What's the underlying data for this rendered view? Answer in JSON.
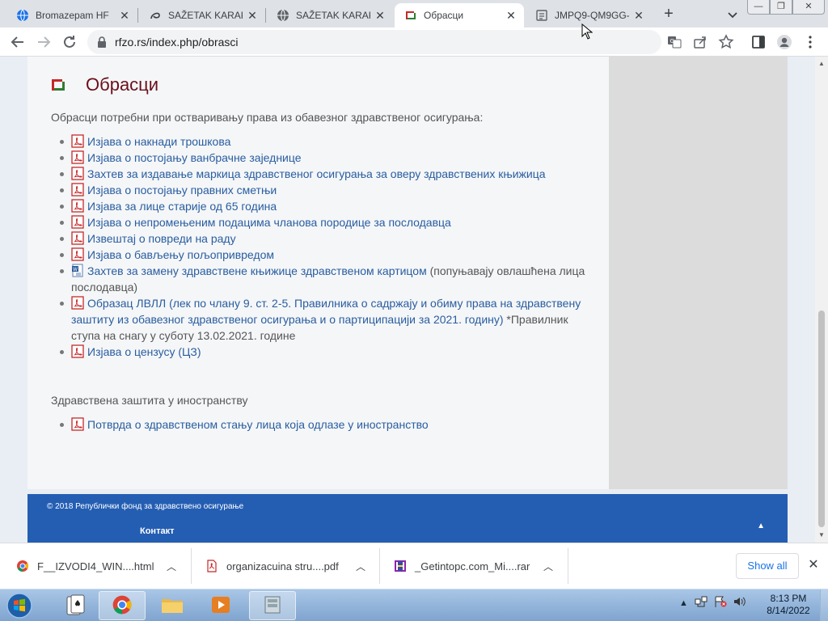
{
  "browser": {
    "tabs": [
      {
        "title": "Bromazepam HF",
        "icon": "globe-icon",
        "active": false
      },
      {
        "title": "SAŽETAK KARAKT",
        "icon": "swirl-icon",
        "active": false
      },
      {
        "title": "SAŽETAK KARAKT",
        "icon": "globe-icon",
        "active": false
      },
      {
        "title": "Обрасци",
        "icon": "rfzo-logo-icon",
        "active": true
      },
      {
        "title": "JMPQ9-QM9GG-",
        "icon": "document-icon",
        "active": false
      }
    ],
    "new_tab_label": "+",
    "url": "rfzo.rs/index.php/obrasci"
  },
  "page": {
    "title": "Обрасци",
    "intro": "Обрасци потребни при остваривању права из обавезног здравственог осигурања:",
    "forms": [
      {
        "icon": "pdf",
        "link": "Изјава о накнади трошкова",
        "note": ""
      },
      {
        "icon": "pdf",
        "link": "Изјава о постојању ванбрачне заједнице",
        "note": ""
      },
      {
        "icon": "pdf",
        "link": "Захтев за издавање маркица здравственог осигурања за оверу здравствених књижица",
        "note": ""
      },
      {
        "icon": "pdf",
        "link": "Изјава о постојању правних сметњи",
        "note": ""
      },
      {
        "icon": "pdf",
        "link": "Изјава за лице старије од 65 година",
        "note": ""
      },
      {
        "icon": "pdf",
        "link": "Изјава о непромењеним подацима чланова породице за послодавца",
        "note": ""
      },
      {
        "icon": "pdf",
        "link": "Извештај о повреди на раду",
        "note": ""
      },
      {
        "icon": "pdf",
        "link": "Изјава о бављењу пољопривредом",
        "note": ""
      },
      {
        "icon": "word",
        "link": "Захтев за замену здравствене књижице здравственом картицом",
        "note": " (попуњавају овлашћена лица послодавца)"
      },
      {
        "icon": "pdf",
        "link": "Образац ЛВЛЛ (лек по члану 9. ст. 2-5. Правилника о садржају и обиму права на здравствену заштиту из обавезног здравственог осигурања и о партиципацији за 2021. годину)",
        "note": " *Правилник ступа на снагу у суботу 13.02.2021. године"
      },
      {
        "icon": "pdf",
        "link": "Изјава о цензусу (ЦЗ)",
        "note": ""
      }
    ],
    "abroad_heading": "Здравствена заштита у иностранству",
    "abroad_forms": [
      {
        "icon": "pdf",
        "link": "Потврда о здравственом стању лица која одлазе у иностранство",
        "note": ""
      }
    ],
    "footer": {
      "copyright": "© 2018 Републички фонд за здравствено осигурање",
      "contact": "Контакт"
    }
  },
  "downloads": {
    "items": [
      {
        "name": "F__IZVODI4_WIN....html",
        "icon": "chrome-icon"
      },
      {
        "name": "organizacuina stru....pdf",
        "icon": "pdf-file-icon"
      },
      {
        "name": "_Getintopc.com_Mi....rar",
        "icon": "rar-archive-icon"
      }
    ],
    "show_all": "Show all"
  },
  "taskbar": {
    "time": "8:13 PM",
    "date": "8/14/2022"
  },
  "colors": {
    "title": "#6b0f1a",
    "link": "#2a5d9f",
    "footer": "#245eb3",
    "pdf_icon": "#c62828"
  }
}
